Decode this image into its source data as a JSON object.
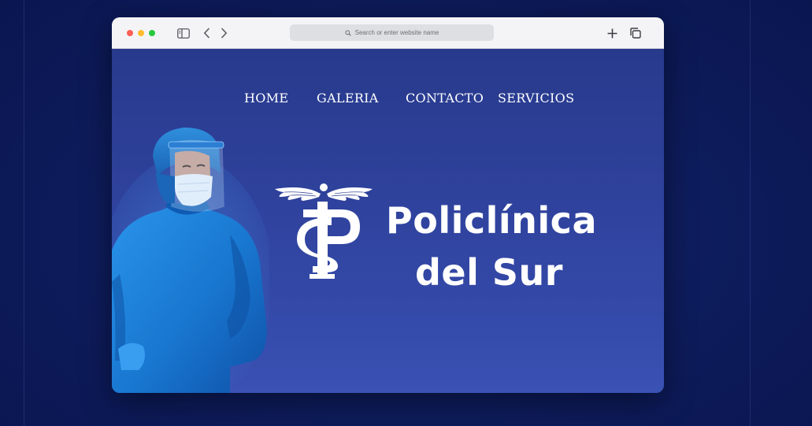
{
  "browser": {
    "window_controls": [
      "close",
      "minimize",
      "zoom"
    ],
    "address_bar": {
      "placeholder": "Search or enter website name",
      "icon": "search-icon"
    },
    "toolbar_icons": [
      "sidebar-icon",
      "back-icon",
      "forward-icon",
      "new-tab-icon",
      "tabs-overview-icon"
    ]
  },
  "nav": {
    "items": [
      {
        "label": "HOME"
      },
      {
        "label": "GALERIA"
      },
      {
        "label": "CONTACTO"
      },
      {
        "label": "SERVICIOS"
      }
    ]
  },
  "brand": {
    "line1": "Policlínica",
    "line2": "del Sur",
    "logo": "caduceus-ps-monogram"
  },
  "colors": {
    "page_background": "#0e1d5e",
    "site_background": "#2e419b",
    "text": "#ffffff",
    "scrubs": "#1f7fd6",
    "close": "#ff5f57",
    "minimize": "#febc2e",
    "zoom": "#28c840"
  }
}
